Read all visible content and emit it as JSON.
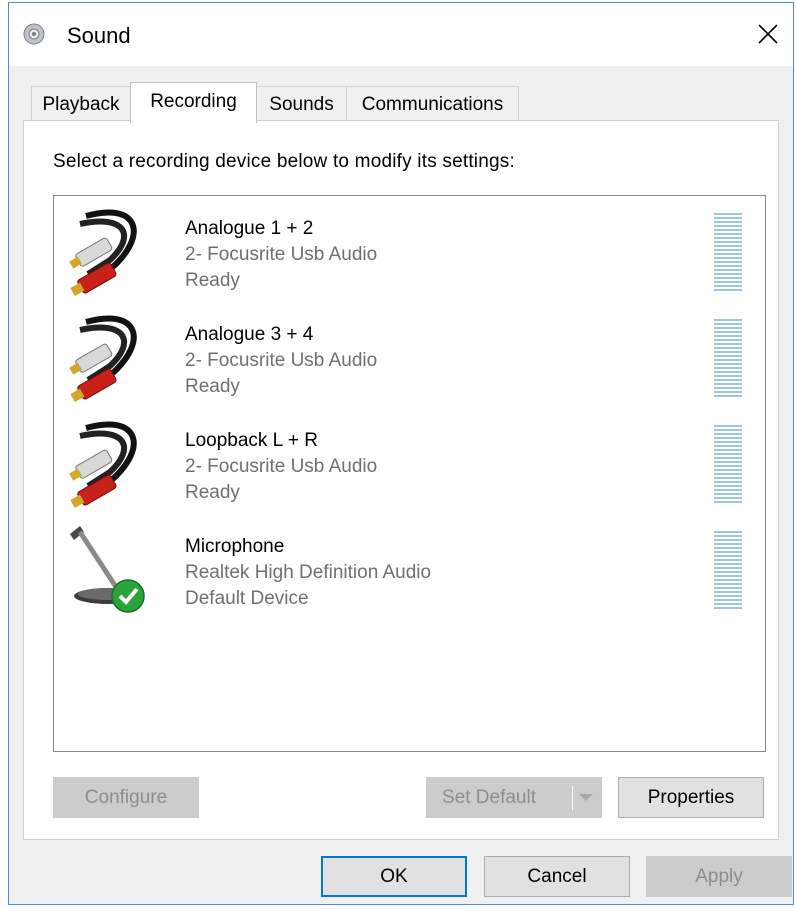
{
  "window": {
    "title": "Sound",
    "close_symbol": "✕"
  },
  "tabs": [
    {
      "label": "Playback",
      "active": false
    },
    {
      "label": "Recording",
      "active": true
    },
    {
      "label": "Sounds",
      "active": false
    },
    {
      "label": "Communications",
      "active": false
    }
  ],
  "instruction": "Select a recording device below to modify its settings:",
  "devices": [
    {
      "name": "Analogue 1 + 2",
      "driver": "2- Focusrite Usb Audio",
      "status": "Ready",
      "icon": "rca-cable-icon"
    },
    {
      "name": "Analogue 3 + 4",
      "driver": "2- Focusrite Usb Audio",
      "status": "Ready",
      "icon": "rca-cable-icon"
    },
    {
      "name": "Loopback L + R",
      "driver": "2- Focusrite Usb Audio",
      "status": "Ready",
      "icon": "rca-cable-icon"
    },
    {
      "name": "Microphone",
      "driver": "Realtek High Definition Audio",
      "status": "Default Device",
      "icon": "microphone-default-icon"
    }
  ],
  "buttons": {
    "configure": "Configure",
    "set_default": "Set Default",
    "properties": "Properties",
    "ok": "OK",
    "cancel": "Cancel",
    "apply": "Apply"
  },
  "colors": {
    "accent": "#0078d7",
    "meter": "#9bc7d8",
    "default_check": "#2aa33a"
  }
}
